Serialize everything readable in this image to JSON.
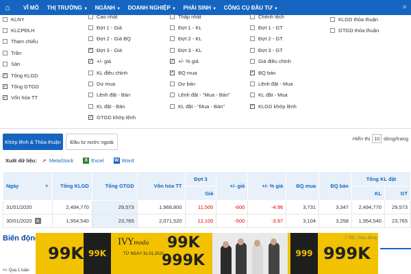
{
  "nav": {
    "home_icon": "home-icon",
    "items": [
      {
        "label": "VĨ MÔ"
      },
      {
        "label": "THỊ TRƯỜNG"
      },
      {
        "label": "NGÀNH"
      },
      {
        "label": "DOANH NGHIỆP"
      },
      {
        "label": "PHÁI SINH"
      },
      {
        "label": "CÔNG CỤ ĐẦU TƯ"
      }
    ]
  },
  "columns": [
    {
      "items": [
        {
          "label": "KLNY",
          "checked": false
        },
        {
          "label": "KLCPĐLH",
          "checked": false
        },
        {
          "label": "Tham chiếu",
          "checked": false
        },
        {
          "label": "Trần",
          "checked": false
        },
        {
          "label": "Sàn",
          "checked": false
        },
        {
          "label": "Tổng KLGD",
          "checked": true
        },
        {
          "label": "Tổng GTGD",
          "checked": true
        },
        {
          "label": "Vốn hóa TT",
          "checked": true
        }
      ]
    },
    {
      "items": [
        {
          "label": "Cao nhất",
          "checked": false
        },
        {
          "label": "Đợt 1 - Giá",
          "checked": false
        },
        {
          "label": "Đợt 2 - Giá BQ",
          "checked": false
        },
        {
          "label": "Đợt 3 - Giá",
          "checked": true
        },
        {
          "label": "+/- giá",
          "checked": true
        },
        {
          "label": "KL điều chỉnh",
          "checked": false
        },
        {
          "label": "Dư mua",
          "checked": false
        },
        {
          "label": "Lệnh đặt - Bán",
          "checked": false
        },
        {
          "label": "KL đặt - Bán",
          "checked": false
        },
        {
          "label": "GTGD khớp lệnh",
          "checked": true
        }
      ]
    },
    {
      "items": [
        {
          "label": "Thấp nhất",
          "checked": false
        },
        {
          "label": "Đợt 1 - KL",
          "checked": false
        },
        {
          "label": "Đợt 2 - KL",
          "checked": false
        },
        {
          "label": "Đợt 3 - KL",
          "checked": false
        },
        {
          "label": "+/- % giá",
          "checked": true
        },
        {
          "label": "BQ mua",
          "checked": true
        },
        {
          "label": "Dư bán",
          "checked": false
        },
        {
          "label": "Lệnh đặt - \"Mua - Bán\"",
          "checked": false
        },
        {
          "label": "KL đặt - \"Mua - Bán\"",
          "checked": false
        }
      ]
    },
    {
      "items": [
        {
          "label": "Chênh lệch",
          "checked": false
        },
        {
          "label": "Đợt 1 - GT",
          "checked": false
        },
        {
          "label": "Đợt 2 - GT",
          "checked": false
        },
        {
          "label": "Đợt 3 - GT",
          "checked": false
        },
        {
          "label": "Giá điều chỉnh",
          "checked": false
        },
        {
          "label": "BQ bán",
          "checked": true
        },
        {
          "label": "Lệnh đặt - Mua",
          "checked": false
        },
        {
          "label": "KL đặt - Mua",
          "checked": false
        },
        {
          "label": "KLGD khớp lệnh",
          "checked": true
        }
      ]
    },
    {
      "items": [
        {
          "label": "KLGD thỏa thuận",
          "checked": false
        },
        {
          "label": "GTGD thỏa thuận",
          "checked": false
        }
      ]
    }
  ],
  "tabs": {
    "active": "Khớp lệnh & Thỏa thuận",
    "other": "Đầu tư nước ngoài"
  },
  "show": {
    "prefix": "Hiển thị",
    "value": "10",
    "suffix": "dòng/trang"
  },
  "export": {
    "label": "Xuất dữ liệu:",
    "options": [
      "MetaStock",
      "Excel",
      "Word"
    ]
  },
  "table": {
    "headers": {
      "date": "Ngày",
      "total_vol": "Tổng KLGD",
      "total_val": "Tổng GTGD",
      "mcap": "Vốn hóa TT",
      "round3": "Đợt 3",
      "price": "Giá",
      "chg": "+/- giá",
      "pct": "+/- % giá",
      "bq_buy": "BQ mua",
      "bq_sell": "BQ bán",
      "matched": "Tổng KL đặt",
      "kl": "KL",
      "gt": "GT"
    },
    "rows": [
      {
        "date": "31/01/2020",
        "total_vol": "2,494,770",
        "total_val": "29,573",
        "mcap": "1,968,800",
        "price": "11,500",
        "chg": "-600",
        "pct": "-4.96",
        "bq_buy": "3,731",
        "bq_sell": "3,347",
        "kl": "2,494,770",
        "gt": "29,573"
      },
      {
        "date": "30/01/2020",
        "total_vol": "1,954,540",
        "total_val": "23,765",
        "mcap": "2,071,520",
        "price": "12,100",
        "chg": "-500",
        "pct": "-3.97",
        "bq_buy": "3,104",
        "bq_sell": "3,258",
        "kl": "1,954,540",
        "gt": "23,765"
      }
    ]
  },
  "ad": {
    "price_left": "99K",
    "price_small": "99K",
    "brand": "IVY",
    "brand_suffix": "moda",
    "date": "TỪ NGÀY 31.01.2020",
    "price_mid": "99K",
    "price_mid2": "999K",
    "price_right": "999K",
    "credit": "ⓘ RD: Triệu đồng"
  },
  "bottom": {
    "heading": "Biến động g",
    "sub": "+/- Qua 1 tuần"
  }
}
